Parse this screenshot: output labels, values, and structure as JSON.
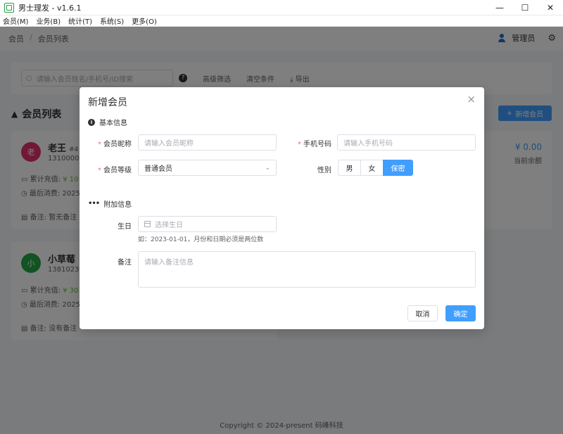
{
  "window": {
    "title": "男士理发 - v1.6.1",
    "controls": {
      "minimize": "—",
      "maximize": "☐",
      "close": "✕"
    }
  },
  "menubar": {
    "items": [
      "会员(M)",
      "业务(B)",
      "统计(T)",
      "系统(S)",
      "更多(O)"
    ]
  },
  "breadcrumb": {
    "root": "会员",
    "current": "会员列表"
  },
  "user": {
    "name": "管理员"
  },
  "filter": {
    "search_placeholder": "请输入会员姓名/手机号/ID搜索",
    "advanced": "高级筛选",
    "clear": "清空条件",
    "export": "导出"
  },
  "list": {
    "title": "会员列表",
    "add_button": "新增会员"
  },
  "members": [
    {
      "avatar": "老",
      "avatar_color": "#e0336f",
      "name": "老王",
      "id": "#4",
      "phone": "1310000",
      "recharge_label": "累计充值: ",
      "recharge_value": "¥ 10",
      "last_label": "最后消费: 2025",
      "note": "备注: 暂无备注",
      "balance": "¥ 0.00",
      "balance_label": "当前余额"
    },
    {
      "avatar": "小",
      "avatar_color": "#22a745",
      "name": "小草莓",
      "phone": "1381023",
      "recharge_label": "累计充值: ",
      "recharge_value": "¥ 30",
      "last_label": "最后消费: 2025",
      "note": "备注: 没有备注"
    }
  ],
  "footer": "Copyright © 2024-present  码峰科技",
  "dialog": {
    "title": "新增会员",
    "close": "×",
    "section_basic": "基本信息",
    "section_extra": "附加信息",
    "nickname": {
      "label": "会员昵称",
      "placeholder": "请输入会员昵称"
    },
    "phone": {
      "label": "手机号码",
      "placeholder": "请输入手机号码"
    },
    "level": {
      "label": "会员等级",
      "value": "普通会员"
    },
    "gender": {
      "label": "性别",
      "options": [
        "男",
        "女",
        "保密"
      ],
      "selected": "保密"
    },
    "birthday": {
      "label": "生日",
      "placeholder": "选择生日",
      "hint": "如：2023-01-01，月份和日期必须是两位数"
    },
    "remark": {
      "label": "备注",
      "placeholder": "请输入备注信息"
    },
    "cancel": "取消",
    "confirm": "确定"
  }
}
